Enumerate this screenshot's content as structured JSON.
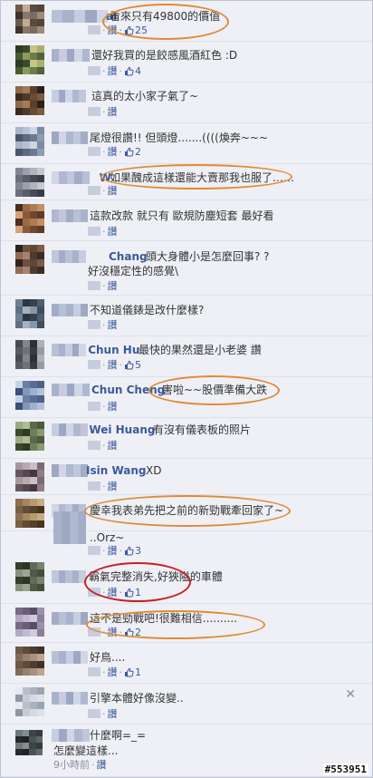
{
  "labels": {
    "like": "讚",
    "sep": "·"
  },
  "colors": {
    "link": "#3b5998",
    "highlight_orange": "#e08a35",
    "highlight_red": "#c52026"
  },
  "comments": [
    {
      "name": "ai",
      "text": "看來只有49800的價值",
      "likes": "25"
    },
    {
      "name": "",
      "text": "還好我買的是餃感風酒紅色 :D",
      "likes": "4"
    },
    {
      "name": "",
      "text": "這真的太小家子氣了~",
      "likes": ""
    },
    {
      "name": "",
      "text": "尾燈很讚!! 但頭燈.......((((煥奔~~~",
      "likes": "2"
    },
    {
      "name": "W",
      "text": "如果醜成這樣還能大賣那我也服了……",
      "likes": ""
    },
    {
      "name": "",
      "text": "這款改款 就只有 歐規防塵短套 最好看",
      "likes": ""
    },
    {
      "name": "Chang",
      "text": "頭大身體小是怎麼回事? ?",
      "text2": "好沒穩定性的感覺\\",
      "likes": ""
    },
    {
      "name": "",
      "text": "不知道儀錶是改什麼樣?",
      "likes": ""
    },
    {
      "name": "Chun Hu",
      "text": "最快的果然還是小老婆 讚",
      "likes": "5"
    },
    {
      "name": "Chun Cheng",
      "text": "害啦~~股價準備大跌",
      "likes": ""
    },
    {
      "name": "Wei Huang",
      "text": "有沒有儀表板的照片",
      "likes": ""
    },
    {
      "name": "Isin Wang",
      "text": "XD",
      "likes": ""
    },
    {
      "name": "",
      "text": "慶幸我表弟先把之前的新勁戰牽回家了~",
      "likes": ""
    },
    {
      "name": "",
      "text": "..Orz~",
      "likes": "3"
    },
    {
      "name": "",
      "text": "霸氣完整消失,好狹隘的車體",
      "likes": "1"
    },
    {
      "name": "",
      "text": "這不是勁戰吧!很難相信..........",
      "likes": "2"
    },
    {
      "name": "",
      "text": "好鳥....",
      "likes": "1"
    },
    {
      "name": "",
      "text": "引擎本體好像沒變..",
      "likes": ""
    },
    {
      "name": "",
      "text": "什麼啊=_=",
      "text2": "怎麼變這樣...",
      "likes": "",
      "time": "9小時前"
    }
  ],
  "close_icon": "✕",
  "watermark": "#553951"
}
